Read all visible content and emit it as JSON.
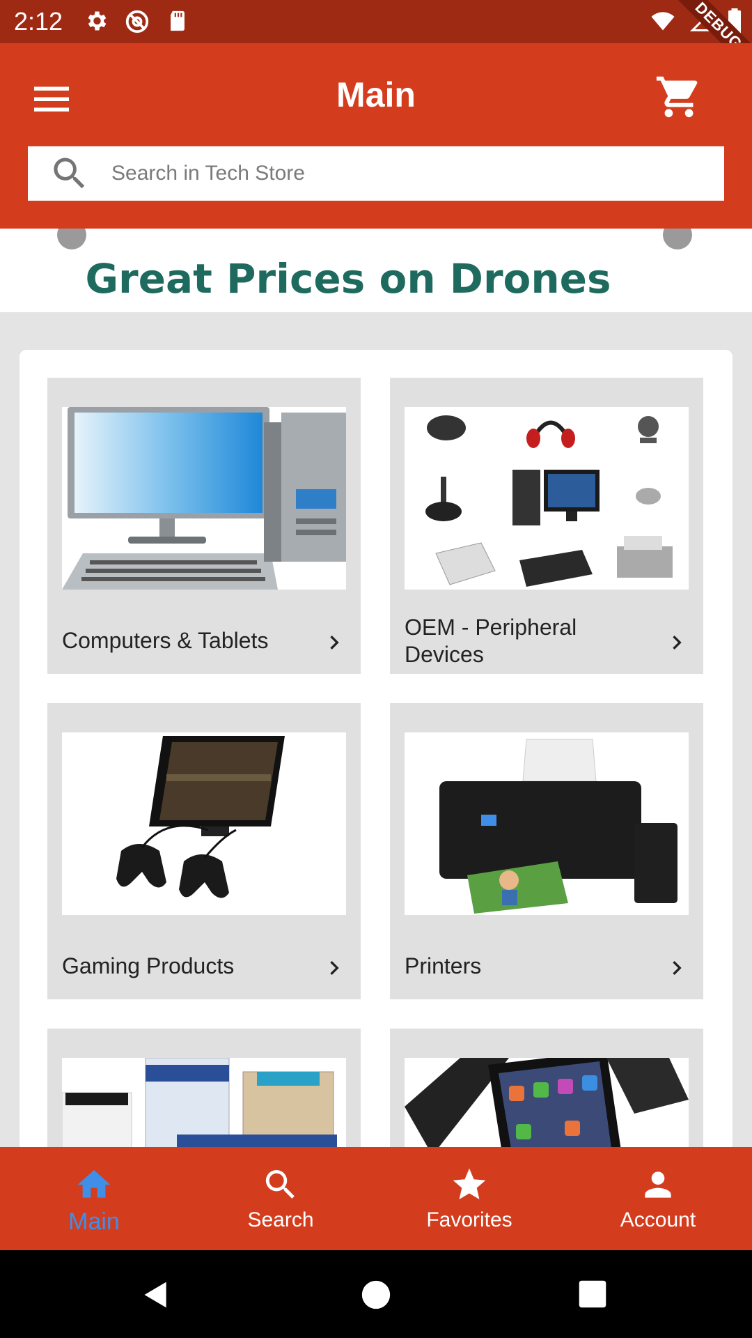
{
  "status_bar": {
    "time": "2:12",
    "left_icons": [
      "gear-icon",
      "at-icon",
      "sd-card-icon"
    ],
    "right_icons": [
      "wifi-icon",
      "signal-icon",
      "battery-icon"
    ],
    "debug_label": "DEBUG"
  },
  "app_bar": {
    "title": "Main",
    "menu_icon": "hamburger-menu-icon",
    "cart_icon": "shopping-cart-icon",
    "background_color": "#d43c1e"
  },
  "search": {
    "placeholder": "Search in Tech Store",
    "icon": "search-icon"
  },
  "banner": {
    "text": "Great Prices on Drones"
  },
  "categories": [
    {
      "label": "Computers & Tablets",
      "image": "desktop-computer-image"
    },
    {
      "label": "OEM - Peripheral Devices",
      "image": "peripherals-image"
    },
    {
      "label": "Gaming Products",
      "image": "gaming-tablet-image"
    },
    {
      "label": "Printers",
      "image": "printer-image"
    },
    {
      "label": "",
      "image": "toner-cartridges-image"
    },
    {
      "label": "",
      "image": "smartphones-image"
    }
  ],
  "bottom_nav": {
    "items": [
      {
        "label": "Main",
        "icon": "home-icon",
        "active": true
      },
      {
        "label": "Search",
        "icon": "search-icon",
        "active": false
      },
      {
        "label": "Favorites",
        "icon": "star-icon",
        "active": false
      },
      {
        "label": "Account",
        "icon": "person-icon",
        "active": false
      }
    ],
    "active_color": "#3f8fe8"
  },
  "system_nav": [
    "back-icon",
    "home-circle-icon",
    "recents-icon"
  ]
}
